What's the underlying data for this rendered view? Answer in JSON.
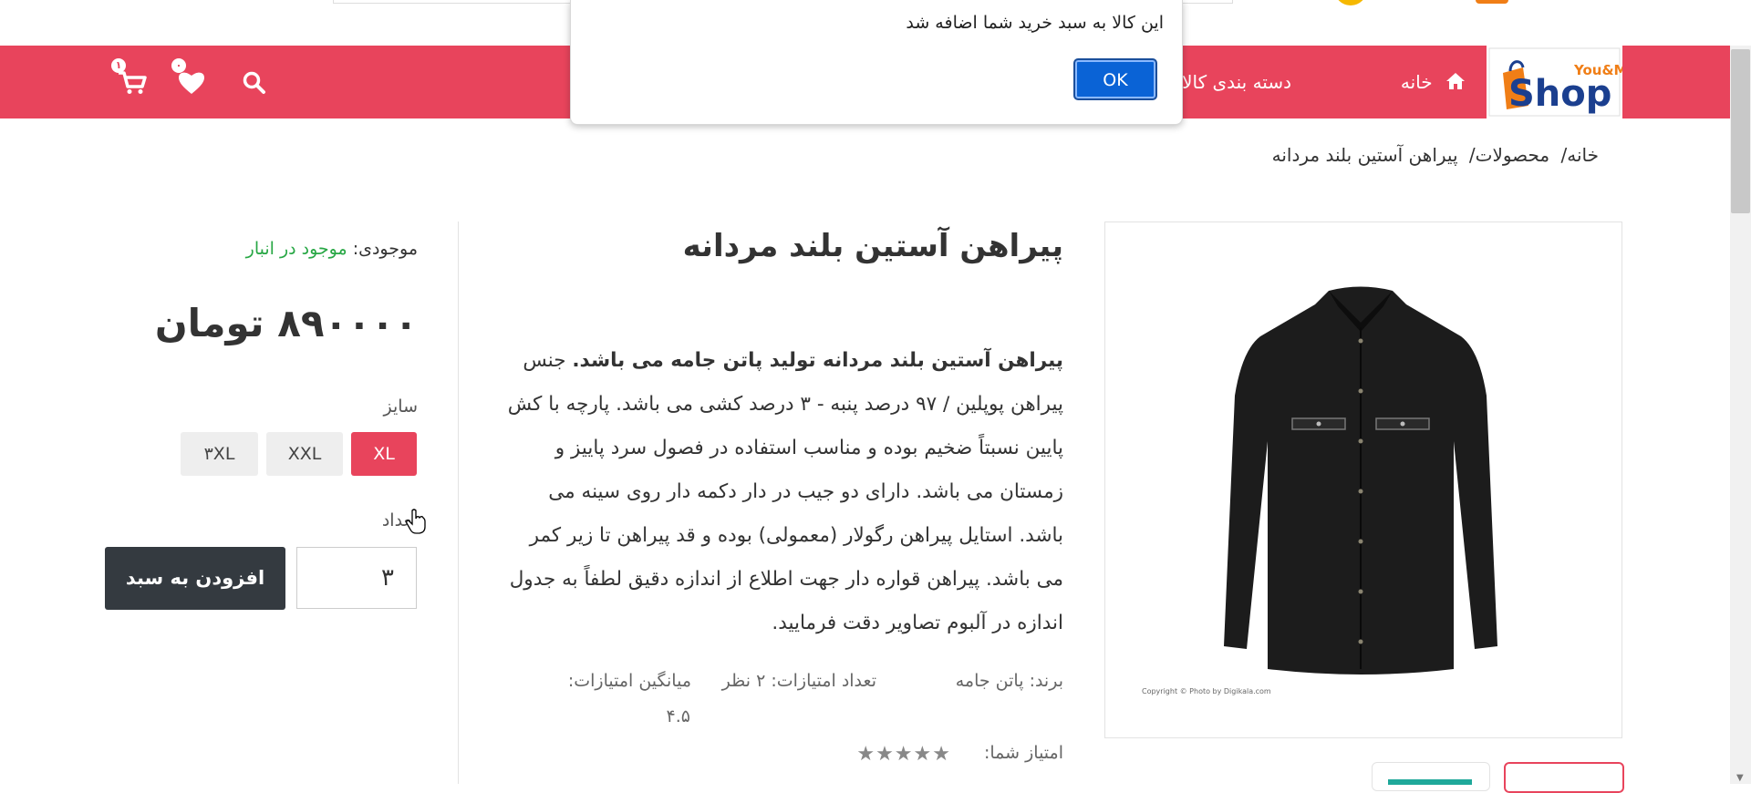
{
  "header": {
    "logo": {
      "top_text": "You&Me",
      "main_text": "Shop"
    },
    "nav": [
      {
        "label": "خانه",
        "icon": "home-icon"
      },
      {
        "label": "دسته بندی کالاها"
      }
    ],
    "wishlist_count": "۰",
    "cart_count": "۱"
  },
  "dialog": {
    "message": "این کالا به سبد خرید شما اضافه شد",
    "ok_label": "OK"
  },
  "breadcrumb": {
    "items": [
      "خانه/",
      "محصولات/",
      "پیراهن آستین بلند مردانه"
    ]
  },
  "product": {
    "title": "پیراهن آستین بلند مردانه",
    "description_bold": "پیراهن آستین بلند مردانه تولید پاتن جامه می باشد.",
    "description_rest": " جنس پیراهن پوپلین / ۹۷ درصد پنبه - ۳ درصد کشی می باشد. پارچه با کش پایین نسبتاً ضخیم بوده و مناسب استفاده در فصول سرد پاییز و زمستان می باشد. دارای دو جیب در دار دکمه دار روی سینه می باشد. استایل پیراهن رگولار (معمولی) بوده و قد پیراهن تا زیر کمر می باشد. پیراهن قواره دار جهت اطلاع از اندازه دقیق لطفاً به جدول اندازه در آلبوم تصاویر دقت فرمایید.",
    "brand_label": "برند:",
    "brand_value": "پاتن جامه",
    "ratings_count_label": "تعداد امتیازات:",
    "ratings_count_value": "۲ نظر",
    "avg_label": "میانگین امتیازات:",
    "avg_value": "۴.۵",
    "your_rating_label": "امتیاز شما:",
    "image_copyright": "Copyright © Photo by Digikala.com"
  },
  "purchase": {
    "stock_label": "موجودی:",
    "stock_value": "موجود در انبار",
    "price": "۸۹۰۰۰۰ تومان",
    "size_label": "سایز",
    "sizes": [
      "XL",
      "XXL",
      "۳XL"
    ],
    "selected_size": "XL",
    "quantity_label": "تعداد",
    "quantity_value": "۳",
    "add_to_cart_label": "افزودن به سبد"
  },
  "colors": {
    "brand": "#e8445c",
    "dark_button": "#343a40",
    "in_stock": "#28a745",
    "dialog_button": "#0a63d6"
  }
}
